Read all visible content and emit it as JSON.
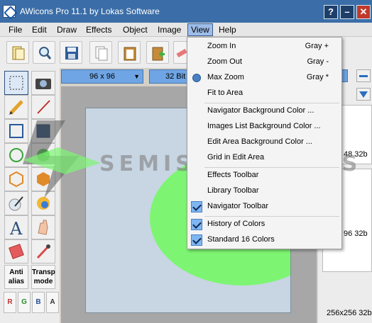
{
  "window": {
    "title": "AWicons Pro 11.1 by Lokas Software"
  },
  "menubar": {
    "items": [
      "File",
      "Edit",
      "Draw",
      "Effects",
      "Object",
      "Image",
      "View",
      "Help"
    ]
  },
  "toolbar": {
    "size": "96 x 96",
    "bit": "32 Bit"
  },
  "palette": {
    "antialias": "Anti alias",
    "transp": "Transp mode",
    "channels": [
      "R",
      "G",
      "B",
      "A"
    ]
  },
  "rightpanel": {
    "labels": [
      "48 32b",
      "96 32b",
      "256x256 32b"
    ]
  },
  "watermark": "SEMISOFTWARES",
  "view_menu": {
    "items": [
      {
        "label": "Zoom In",
        "shortcut": "Gray +"
      },
      {
        "label": "Zoom Out",
        "shortcut": "Gray -"
      },
      {
        "label": "Max Zoom",
        "shortcut": "Gray *"
      },
      {
        "label": "Fit to Area",
        "shortcut": ""
      },
      {
        "label": "Navigator Background Color ...",
        "shortcut": ""
      },
      {
        "label": "Images List Background Color ...",
        "shortcut": ""
      },
      {
        "label": "Edit Area Background Color ...",
        "shortcut": ""
      },
      {
        "label": "Grid in Edit Area",
        "shortcut": ""
      },
      {
        "label": "Effects Toolbar",
        "shortcut": ""
      },
      {
        "label": "Library Toolbar",
        "shortcut": ""
      },
      {
        "label": "Navigator Toolbar",
        "shortcut": ""
      },
      {
        "label": "History of Colors",
        "shortcut": ""
      },
      {
        "label": "Standard 16 Colors",
        "shortcut": ""
      }
    ]
  }
}
